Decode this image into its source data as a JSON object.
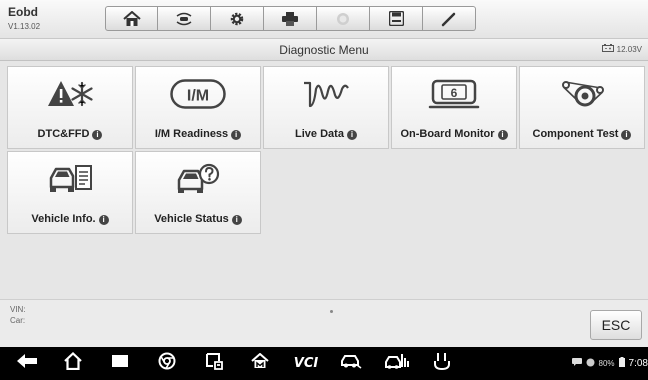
{
  "app": {
    "name": "Eobd",
    "version": "V1.13.02"
  },
  "toolbar": {
    "buttons": [
      {
        "icon": "home-icon"
      },
      {
        "icon": "vehicle-swap-icon"
      },
      {
        "icon": "gear-icon"
      },
      {
        "icon": "printer-icon"
      },
      {
        "icon": "help-icon"
      },
      {
        "icon": "save-icon"
      },
      {
        "icon": "pen-icon"
      }
    ]
  },
  "header": {
    "title": "Diagnostic Menu",
    "voltage": "12.03V"
  },
  "tiles": [
    {
      "label": "DTC&FFD",
      "icon": "warning-snowflake-icon"
    },
    {
      "label": "I/M Readiness",
      "icon": "im-readiness-icon",
      "icon_text": "I/M"
    },
    {
      "label": "Live Data",
      "icon": "waveform-icon"
    },
    {
      "label": "On-Board Monitor",
      "icon": "monitor-6-icon",
      "icon_text": "6"
    },
    {
      "label": "Component Test",
      "icon": "belt-pulley-icon"
    },
    {
      "label": "Vehicle Info.",
      "icon": "car-document-icon"
    },
    {
      "label": "Vehicle Status",
      "icon": "car-question-icon"
    }
  ],
  "info": {
    "vin_label": "VIN:",
    "car_label": "Car:",
    "esc_label": "ESC"
  },
  "navbar": {
    "vci_label": "VCI",
    "battery": "80%",
    "time": "7:08"
  },
  "colors": {
    "background": "#e6e6e6",
    "tile": "#ffffff",
    "navbar": "#000000"
  }
}
